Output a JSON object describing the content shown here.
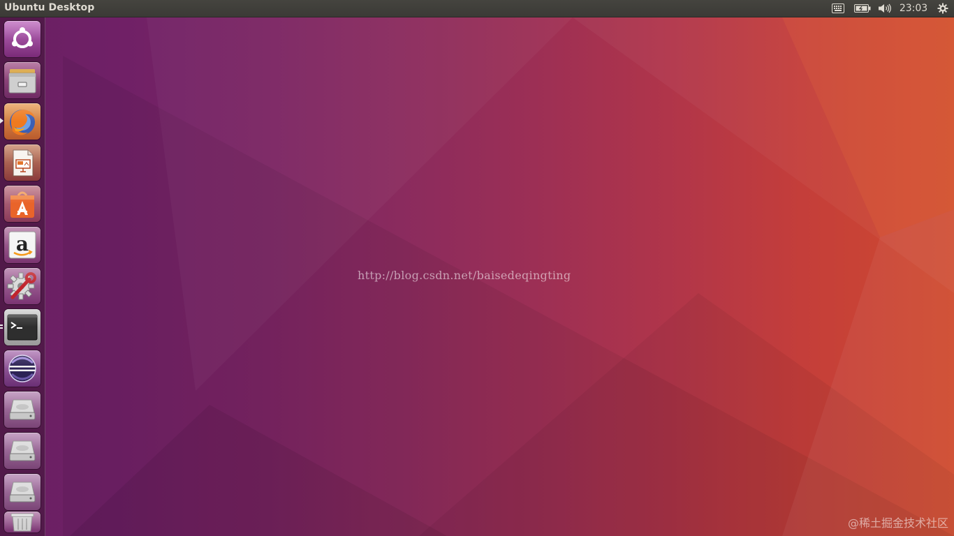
{
  "top_panel": {
    "title": "Ubuntu Desktop",
    "indicators": [
      {
        "name": "keyboard-icon"
      },
      {
        "name": "battery-icon"
      },
      {
        "name": "volume-icon"
      },
      {
        "name": "clock",
        "text": "23:03"
      },
      {
        "name": "gear-icon"
      }
    ]
  },
  "launcher": {
    "items": [
      {
        "name": "ubuntu-dash-icon",
        "running": false
      },
      {
        "name": "files-icon",
        "running": false
      },
      {
        "name": "firefox-icon",
        "running": true
      },
      {
        "name": "libreoffice-impress-icon",
        "running": false
      },
      {
        "name": "ubuntu-software-icon",
        "running": false
      },
      {
        "name": "amazon-icon",
        "running": false
      },
      {
        "name": "system-settings-icon",
        "running": false
      },
      {
        "name": "terminal-icon",
        "running": true
      },
      {
        "name": "eclipse-icon",
        "running": false
      },
      {
        "name": "drive-icon",
        "running": false
      },
      {
        "name": "drive-icon",
        "running": false
      },
      {
        "name": "drive-icon",
        "running": false
      },
      {
        "name": "trash-icon",
        "running": false
      }
    ]
  },
  "desktop": {
    "watermark_url": "http://blog.csdn.net/baisedeqingting",
    "watermark_corner": "@稀土掘金技术社区"
  },
  "colors": {
    "panel": "#3c3b37",
    "wallpaper_left": "#6a1f63",
    "wallpaper_right": "#cf4a2e",
    "launcher_bg": "#4a1a42"
  }
}
